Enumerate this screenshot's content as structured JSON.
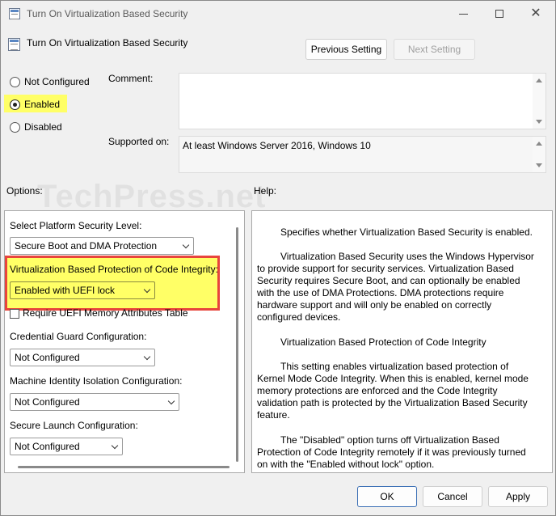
{
  "window": {
    "title": "Turn On Virtualization Based Security",
    "icons": {
      "app": "policy-doc-icon",
      "minimize": "minimize-icon",
      "maximize": "maximize-icon",
      "close": "close-icon"
    }
  },
  "header": {
    "policy_title": "Turn On Virtualization Based Security",
    "previous_label": "Previous Setting",
    "next_label": "Next Setting"
  },
  "state": {
    "options": [
      {
        "label": "Not Configured",
        "checked": false
      },
      {
        "label": "Enabled",
        "checked": true
      },
      {
        "label": "Disabled",
        "checked": false
      }
    ]
  },
  "comment": {
    "label": "Comment:",
    "value": ""
  },
  "supported": {
    "label": "Supported on:",
    "value": "At least Windows Server 2016, Windows 10"
  },
  "watermark": "TechPress.net",
  "sections": {
    "options_label": "Options:",
    "help_label": "Help:"
  },
  "options_panel": {
    "platform_label": "Select Platform Security Level:",
    "platform_value": "Secure Boot and DMA Protection",
    "vbs_label": "Virtualization Based Protection of Code Integrity:",
    "vbs_value": "Enabled with UEFI lock",
    "uefi_checkbox_label": "Require UEFI Memory Attributes Table",
    "uefi_checked": false,
    "credential_label": "Credential Guard Configuration:",
    "credential_value": "Not Configured",
    "machine_label": "Machine Identity Isolation Configuration:",
    "machine_value": "Not Configured",
    "launch_label": "Secure Launch Configuration:",
    "launch_value": "Not Configured"
  },
  "help": {
    "p1": "Specifies whether Virtualization Based Security is enabled.",
    "p2": "Virtualization Based Security uses the Windows Hypervisor to provide support for security services. Virtualization Based Security requires Secure Boot, and can optionally be enabled with the use of DMA Protections. DMA protections require hardware support and will only be enabled on correctly configured devices.",
    "p3": "Virtualization Based Protection of Code Integrity",
    "p4": "This setting enables virtualization based protection of Kernel Mode Code Integrity. When this is enabled, kernel mode memory protections are enforced and the Code Integrity validation path is protected by the Virtualization Based Security feature.",
    "p5": "The \"Disabled\" option turns off Virtualization Based Protection of Code Integrity remotely if it was previously turned on with the \"Enabled without lock\" option."
  },
  "footer": {
    "ok_label": "OK",
    "cancel_label": "Cancel",
    "apply_label": "Apply"
  },
  "colors": {
    "highlight": "#ffff66",
    "callout_border": "#e8453c",
    "primary_border": "#3b6fb5"
  }
}
